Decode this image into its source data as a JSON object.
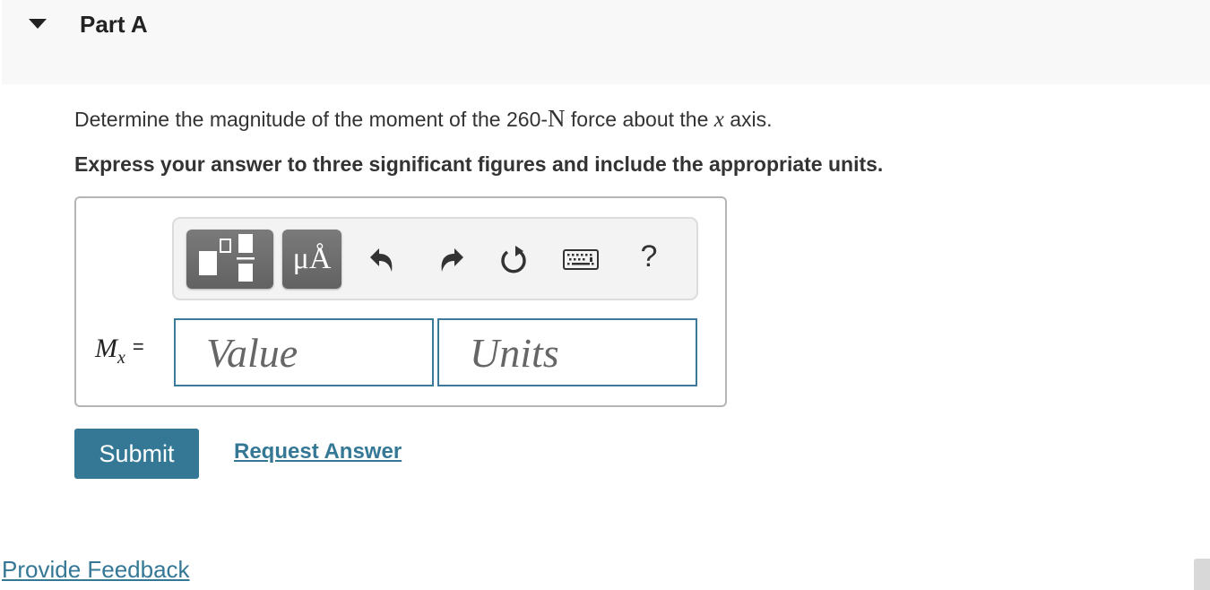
{
  "part": {
    "title": "Part A",
    "expanded": true
  },
  "question": {
    "prefix": "Determine the magnitude of the moment of the 260-",
    "force_unit": "N",
    "middle": " force about the ",
    "axis_var": "x",
    "suffix": " axis."
  },
  "instruction": "Express your answer to three significant figures and include the appropriate units.",
  "toolbar": {
    "buttons": [
      {
        "icon": "templates-icon",
        "label": ""
      },
      {
        "icon": "units-icon",
        "label": "μÅ"
      },
      {
        "icon": "undo-icon"
      },
      {
        "icon": "redo-icon"
      },
      {
        "icon": "reset-icon"
      },
      {
        "icon": "keyboard-icon"
      },
      {
        "icon": "help-icon",
        "label": "?"
      }
    ]
  },
  "answer": {
    "label_var": "M",
    "label_sub": "x",
    "equals": "=",
    "value_placeholder": "Value",
    "units_placeholder": "Units",
    "value": "",
    "units": ""
  },
  "actions": {
    "submit_label": "Submit",
    "request_answer_label": "Request Answer"
  },
  "footer": {
    "feedback_label": "Provide Feedback"
  },
  "colors": {
    "accent": "#357896",
    "header_bg": "#f8f8f8",
    "toolbar_bg": "#f3f3f3"
  }
}
